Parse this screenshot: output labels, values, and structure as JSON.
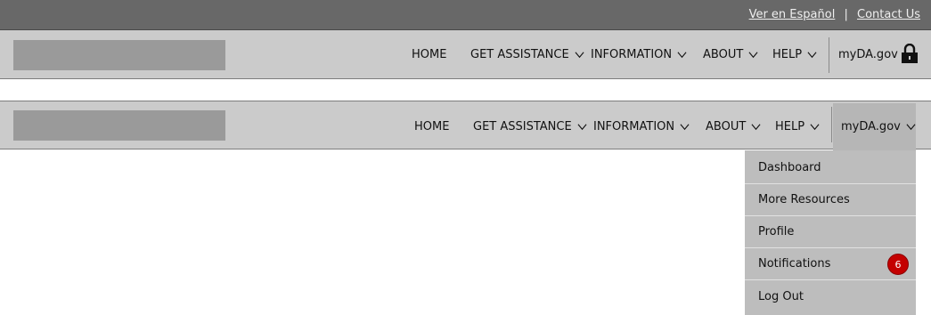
{
  "utility": {
    "spanish_link": "Ver en Español",
    "separator": "|",
    "contact_link": "Contact Us"
  },
  "nav": {
    "home": "HOME",
    "get_assistance": "GET ASSISTANCE",
    "information": "INFORMATION",
    "about": "ABOUT",
    "help": "HELP",
    "account": "myDA.gov"
  },
  "dropdown": {
    "items": [
      {
        "label": "Dashboard"
      },
      {
        "label": "More Resources"
      },
      {
        "label": "Profile"
      },
      {
        "label": "Notifications",
        "badge": "6"
      },
      {
        "label": "Log Out"
      }
    ]
  },
  "colors": {
    "utility_bar": "#686868",
    "nav_bar": "#cbcbcb",
    "dropdown": "#bdbdbd",
    "badge": "#c40000"
  },
  "icons": {
    "lock": "lock-icon",
    "chevron": "chevron-down-icon"
  }
}
